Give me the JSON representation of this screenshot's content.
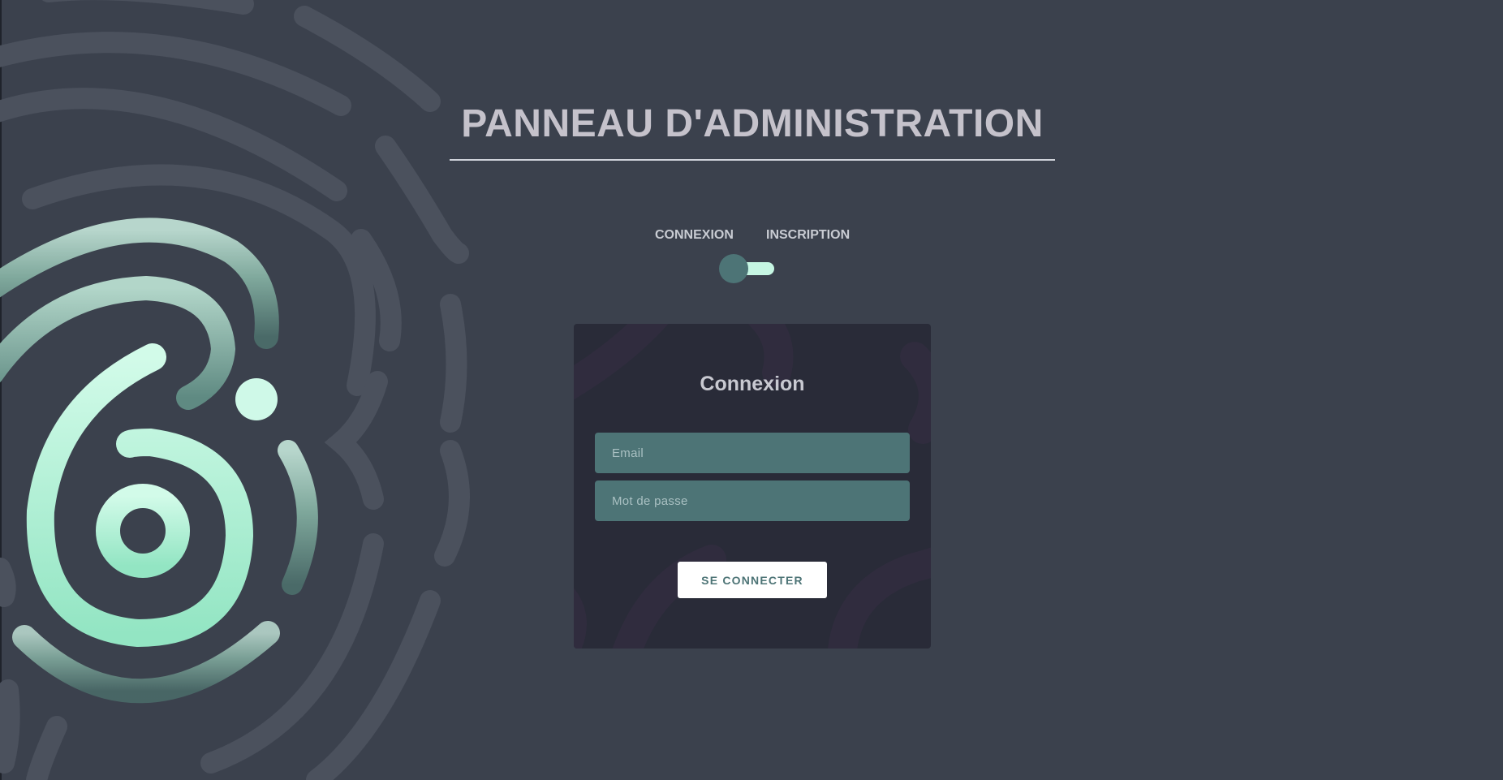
{
  "header": {
    "title": "PANNEAU D'ADMINISTRATION"
  },
  "tabs": {
    "login_label": "CONNEXION",
    "signup_label": "INSCRIPTION",
    "toggle_state": "connexion"
  },
  "login_card": {
    "title": "Connexion",
    "email_placeholder": "Email",
    "password_placeholder": "Mot de passe",
    "submit_label": "SE CONNECTER"
  },
  "colors": {
    "page_background": "#3b414d",
    "accent_teal": "#4d7476",
    "accent_mint": "#c6f6e3",
    "card_background": "#292b38",
    "title_text": "#c5c2cb"
  },
  "icons": {
    "logo": "fingerprint-six-logo"
  }
}
